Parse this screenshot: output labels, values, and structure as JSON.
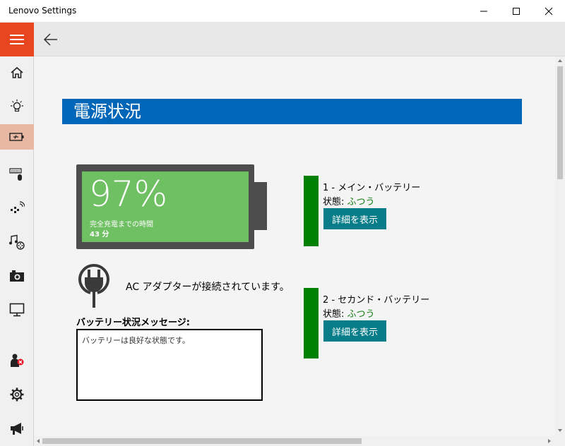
{
  "window": {
    "title": "Lenovo Settings"
  },
  "sidebar": {
    "items": [
      {
        "icon": "home-icon"
      },
      {
        "icon": "lightbulb-icon"
      },
      {
        "icon": "battery-icon",
        "active": true
      },
      {
        "icon": "keyboard-mouse-icon"
      },
      {
        "icon": "network-icon"
      },
      {
        "icon": "audio-video-icon"
      },
      {
        "icon": "camera-icon"
      },
      {
        "icon": "display-icon"
      },
      {
        "icon": "user-error-icon"
      },
      {
        "icon": "settings-gear-icon"
      },
      {
        "icon": "megaphone-icon"
      }
    ],
    "accent_color": "#e8461e",
    "active_color": "#e8b8a3"
  },
  "main": {
    "title": "電源状況",
    "battery": {
      "percent": "97%",
      "fill_fraction": 0.97,
      "label": "完全充電までの時間",
      "time": "43 分"
    },
    "ac_adapter": {
      "icon": "power-plug-icon",
      "text": "AC アダプターが接続されています。"
    },
    "message": {
      "label": "バッテリー状況メッセージ:",
      "text": "バッテリーは良好な状態です。"
    },
    "batteries": [
      {
        "name": "1 - メイン・バッテリー",
        "status_label": "状態: ",
        "status_value": "ふつう",
        "detail_button": "詳細を表示"
      },
      {
        "name": "2 - セカンド・バッテリー",
        "status_label": "状態: ",
        "status_value": "ふつう",
        "detail_button": "詳細を表示"
      }
    ]
  },
  "colors": {
    "title_bar": "#0067b8",
    "battery_fill": "#6fbf63",
    "battery_indicator": "#008000",
    "detail_button": "#067d88",
    "status_ok": "#107c10"
  }
}
